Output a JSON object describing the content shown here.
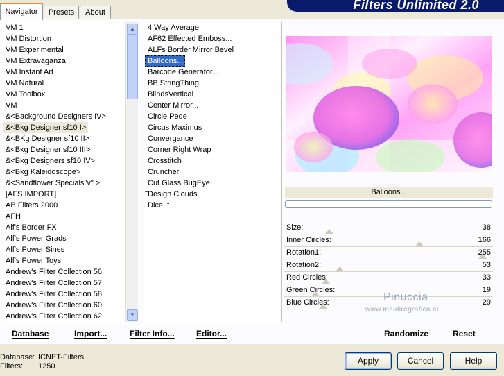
{
  "tabs": [
    {
      "label": "Navigator",
      "active": true
    },
    {
      "label": "Presets",
      "active": false
    },
    {
      "label": "About",
      "active": false
    }
  ],
  "banner": {
    "title": "Filters Unlimited 2.0",
    "color": "#0a1a6a"
  },
  "categories": {
    "items": [
      "VM 1",
      "VM Distortion",
      "VM Experimental",
      "VM Extravaganza",
      "VM Instant Art",
      "VM Natural",
      "VM Toolbox",
      "VM",
      "&<Background Designers IV>",
      "&<Bkg Designer sf10 I>",
      "&<BKg Designer sf10 II>",
      "&<Bkg Designer sf10 III>",
      "&<Bkg Designers sf10 IV>",
      "&<Bkg Kaleidoscope>",
      "&<Sandflower Specials\"v\" >",
      "[AFS IMPORT]",
      "AB Filters 2000",
      "AFH",
      "Alf's Border FX",
      "Alf's Power Grads",
      "Alf's Power Sines",
      "Alf's Power Toys",
      "Andrew's Filter Collection 56",
      "Andrew's Filter Collection 57",
      "Andrew's Filter Collection 58",
      "Andrew's Filter Collection 60",
      "Andrew's Filter Collection 62"
    ],
    "highlighted": "&<Bkg Designer sf10 I>"
  },
  "filters": {
    "items": [
      "4 Way Average",
      "AF62 Effected Emboss...",
      "ALFs Border Mirror Bevel",
      "Balloons...",
      "Barcode Generator...",
      "BB StringThing..",
      "BlindsVertical",
      "Center Mirror...",
      "Circle Pede",
      "Circus Maximus",
      "Convergance",
      "Corner Right Wrap",
      "Crosstitch",
      "Cruncher",
      "Cut Glass  BugEye",
      "Design Clouds",
      "Dice It"
    ],
    "selected": "Balloons..."
  },
  "preview": {
    "filter_name": "Balloons...",
    "progress": 0
  },
  "parameters": [
    {
      "name": "Size:",
      "value": 38
    },
    {
      "name": "Inner Circles:",
      "value": 166
    },
    {
      "name": "Rotation1:",
      "value": 255
    },
    {
      "name": "Rotation2:",
      "value": 53
    },
    {
      "name": "Red Circles:",
      "value": 33
    },
    {
      "name": "Green Circles:",
      "value": 19
    },
    {
      "name": "Blue Circles:",
      "value": 29
    }
  ],
  "watermark": {
    "name": "Pinuccia",
    "site": "www.maidiregrafica.eu"
  },
  "links": {
    "database": "Database",
    "import": "Import...",
    "filter_info": "Filter Info...",
    "editor": "Editor...",
    "randomize": "Randomize",
    "reset": "Reset"
  },
  "footer": {
    "database_label": "Database:",
    "database_value": "ICNET-Filters",
    "filters_label": "Filters:",
    "filters_value": "1250"
  },
  "buttons": {
    "apply": "Apply",
    "cancel": "Cancel",
    "help": "Help"
  }
}
